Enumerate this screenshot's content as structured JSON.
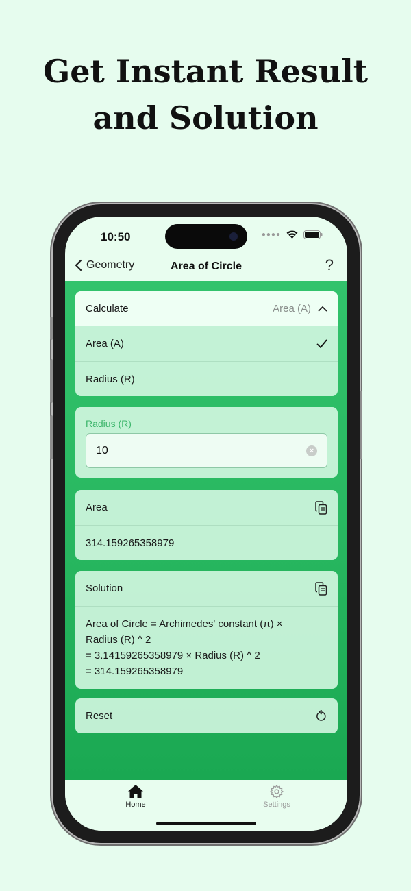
{
  "headline": {
    "line1": "Get Instant Result",
    "line2": "and Solution"
  },
  "status": {
    "time": "10:50"
  },
  "nav": {
    "back_label": "Geometry",
    "title": "Area of Circle",
    "help": "?"
  },
  "calculate": {
    "label": "Calculate",
    "selected": "Area (A)",
    "options": [
      {
        "label": "Area (A)",
        "checked": true
      },
      {
        "label": "Radius (R)",
        "checked": false
      }
    ]
  },
  "radius_input": {
    "label": "Radius (R)",
    "value": "10"
  },
  "area": {
    "label": "Area",
    "value": "314.159265358979"
  },
  "solution": {
    "label": "Solution",
    "lines": [
      "Area of Circle = Archimedes' constant (π) ×",
      "Radius (R) ^ 2",
      "= 3.14159265358979 × Radius (R) ^ 2",
      "= 314.159265358979"
    ]
  },
  "reset": {
    "label": "Reset"
  },
  "tabs": [
    {
      "label": "Home",
      "icon": "home-icon",
      "active": true
    },
    {
      "label": "Settings",
      "icon": "gear-icon",
      "active": false
    }
  ],
  "colors": {
    "accent": "#27b65f",
    "background": "#e6fcee",
    "label_green": "#3db66c"
  }
}
